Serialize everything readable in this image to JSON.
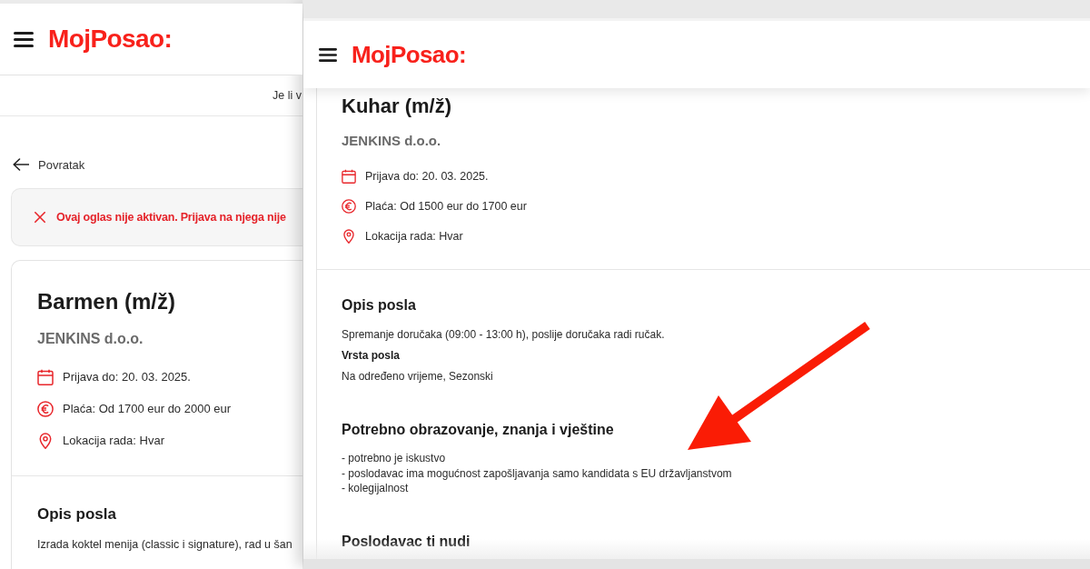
{
  "back_window": {
    "header": {
      "logo": "MojPosao:"
    },
    "notice_bar": {
      "text": "Je li v"
    },
    "back_link": {
      "label": "Povratak"
    },
    "alert": {
      "text": "Ovaj oglas nije aktivan. Prijava na njega nije"
    },
    "job": {
      "title": "Barmen (m/ž)",
      "company": "JENKINS d.o.o.",
      "details": [
        {
          "kind": "deadline",
          "text": "Prijava do: 20. 03. 2025."
        },
        {
          "kind": "salary",
          "text": "Plaća: Od 1700 eur do 2000 eur"
        },
        {
          "kind": "location",
          "text": "Lokacija rada: Hvar"
        }
      ],
      "sections": [
        {
          "heading": "Opis posla",
          "items": [
            {
              "kind": "text",
              "text": "Izrada koktel menija (classic i signature), rad u šan"
            }
          ]
        }
      ]
    }
  },
  "front_window": {
    "header": {
      "logo": "MojPosao:"
    },
    "job": {
      "title": "Kuhar (m/ž)",
      "company": "JENKINS d.o.o.",
      "details": [
        {
          "kind": "deadline",
          "text": "Prijava do: 20. 03. 2025."
        },
        {
          "kind": "salary",
          "text": "Plaća: Od 1500 eur do 1700 eur"
        },
        {
          "kind": "location",
          "text": "Lokacija rada: Hvar"
        }
      ],
      "sections": [
        {
          "heading": "Opis posla",
          "items": [
            {
              "kind": "text",
              "text": "Spremanje doručaka (09:00 - 13:00 h), poslije doručaka radi ručak."
            },
            {
              "kind": "label",
              "text": "Vrsta posla"
            },
            {
              "kind": "text",
              "text": "Na određeno vrijeme, Sezonski"
            }
          ]
        },
        {
          "heading": "Potrebno obrazovanje, znanja i vještine",
          "items": [
            {
              "kind": "bullet",
              "text": "- potrebno je iskustvo"
            },
            {
              "kind": "bullet",
              "text": "- poslodavac ima mogućnost zapošljavanja samo kandidata s EU državljanstvom"
            },
            {
              "kind": "bullet",
              "text": "- kolegijalnost"
            }
          ]
        },
        {
          "heading": "Poslodavac ti nudi"
        }
      ]
    }
  },
  "annotations": [
    {
      "kind": "arrow"
    }
  ]
}
